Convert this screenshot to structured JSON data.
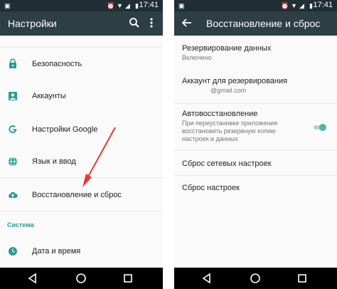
{
  "left": {
    "status": {
      "time": "17:41"
    },
    "appbar": {
      "title": "Настройки",
      "search_icon": "search-icon",
      "more_icon": "more-vert-icon"
    },
    "items": [
      {
        "label": "Безопасность",
        "icon": "lock-icon"
      },
      {
        "label": "Аккаунты",
        "icon": "account-box-icon"
      },
      {
        "label": "Настройки Google",
        "icon": "google-icon"
      },
      {
        "label": "Язык и ввод",
        "icon": "globe-icon"
      },
      {
        "label": "Восстановление и сброс",
        "icon": "cloud-upload-icon"
      }
    ],
    "section": "Система",
    "system_items": [
      {
        "label": "Дата и время",
        "icon": "clock-icon"
      }
    ]
  },
  "right": {
    "status": {
      "time": "17:41"
    },
    "appbar": {
      "title": "Восстановление и сброс",
      "back_icon": "back-arrow-icon"
    },
    "backup": {
      "title": "Резервирование данных",
      "sub": "Включено"
    },
    "account": {
      "title": "Аккаунт для резервирования",
      "sub": "@gmail.com"
    },
    "autorestore": {
      "title": "Автовосстановление",
      "sub": [
        "При переустановке приложения",
        "восстановить резервную копию",
        "настроек и данных"
      ],
      "toggle_on": true
    },
    "network_reset": {
      "title": "Сброс сетевых настроек"
    },
    "factory_reset": {
      "title": "Сброс настроек"
    }
  },
  "colors": {
    "statusbar": "#1f2f35",
    "appbar": "#2e3e45",
    "accent": "#2a9d8f",
    "toggle_on": "#4db6ac",
    "arrow": "#e53935"
  }
}
